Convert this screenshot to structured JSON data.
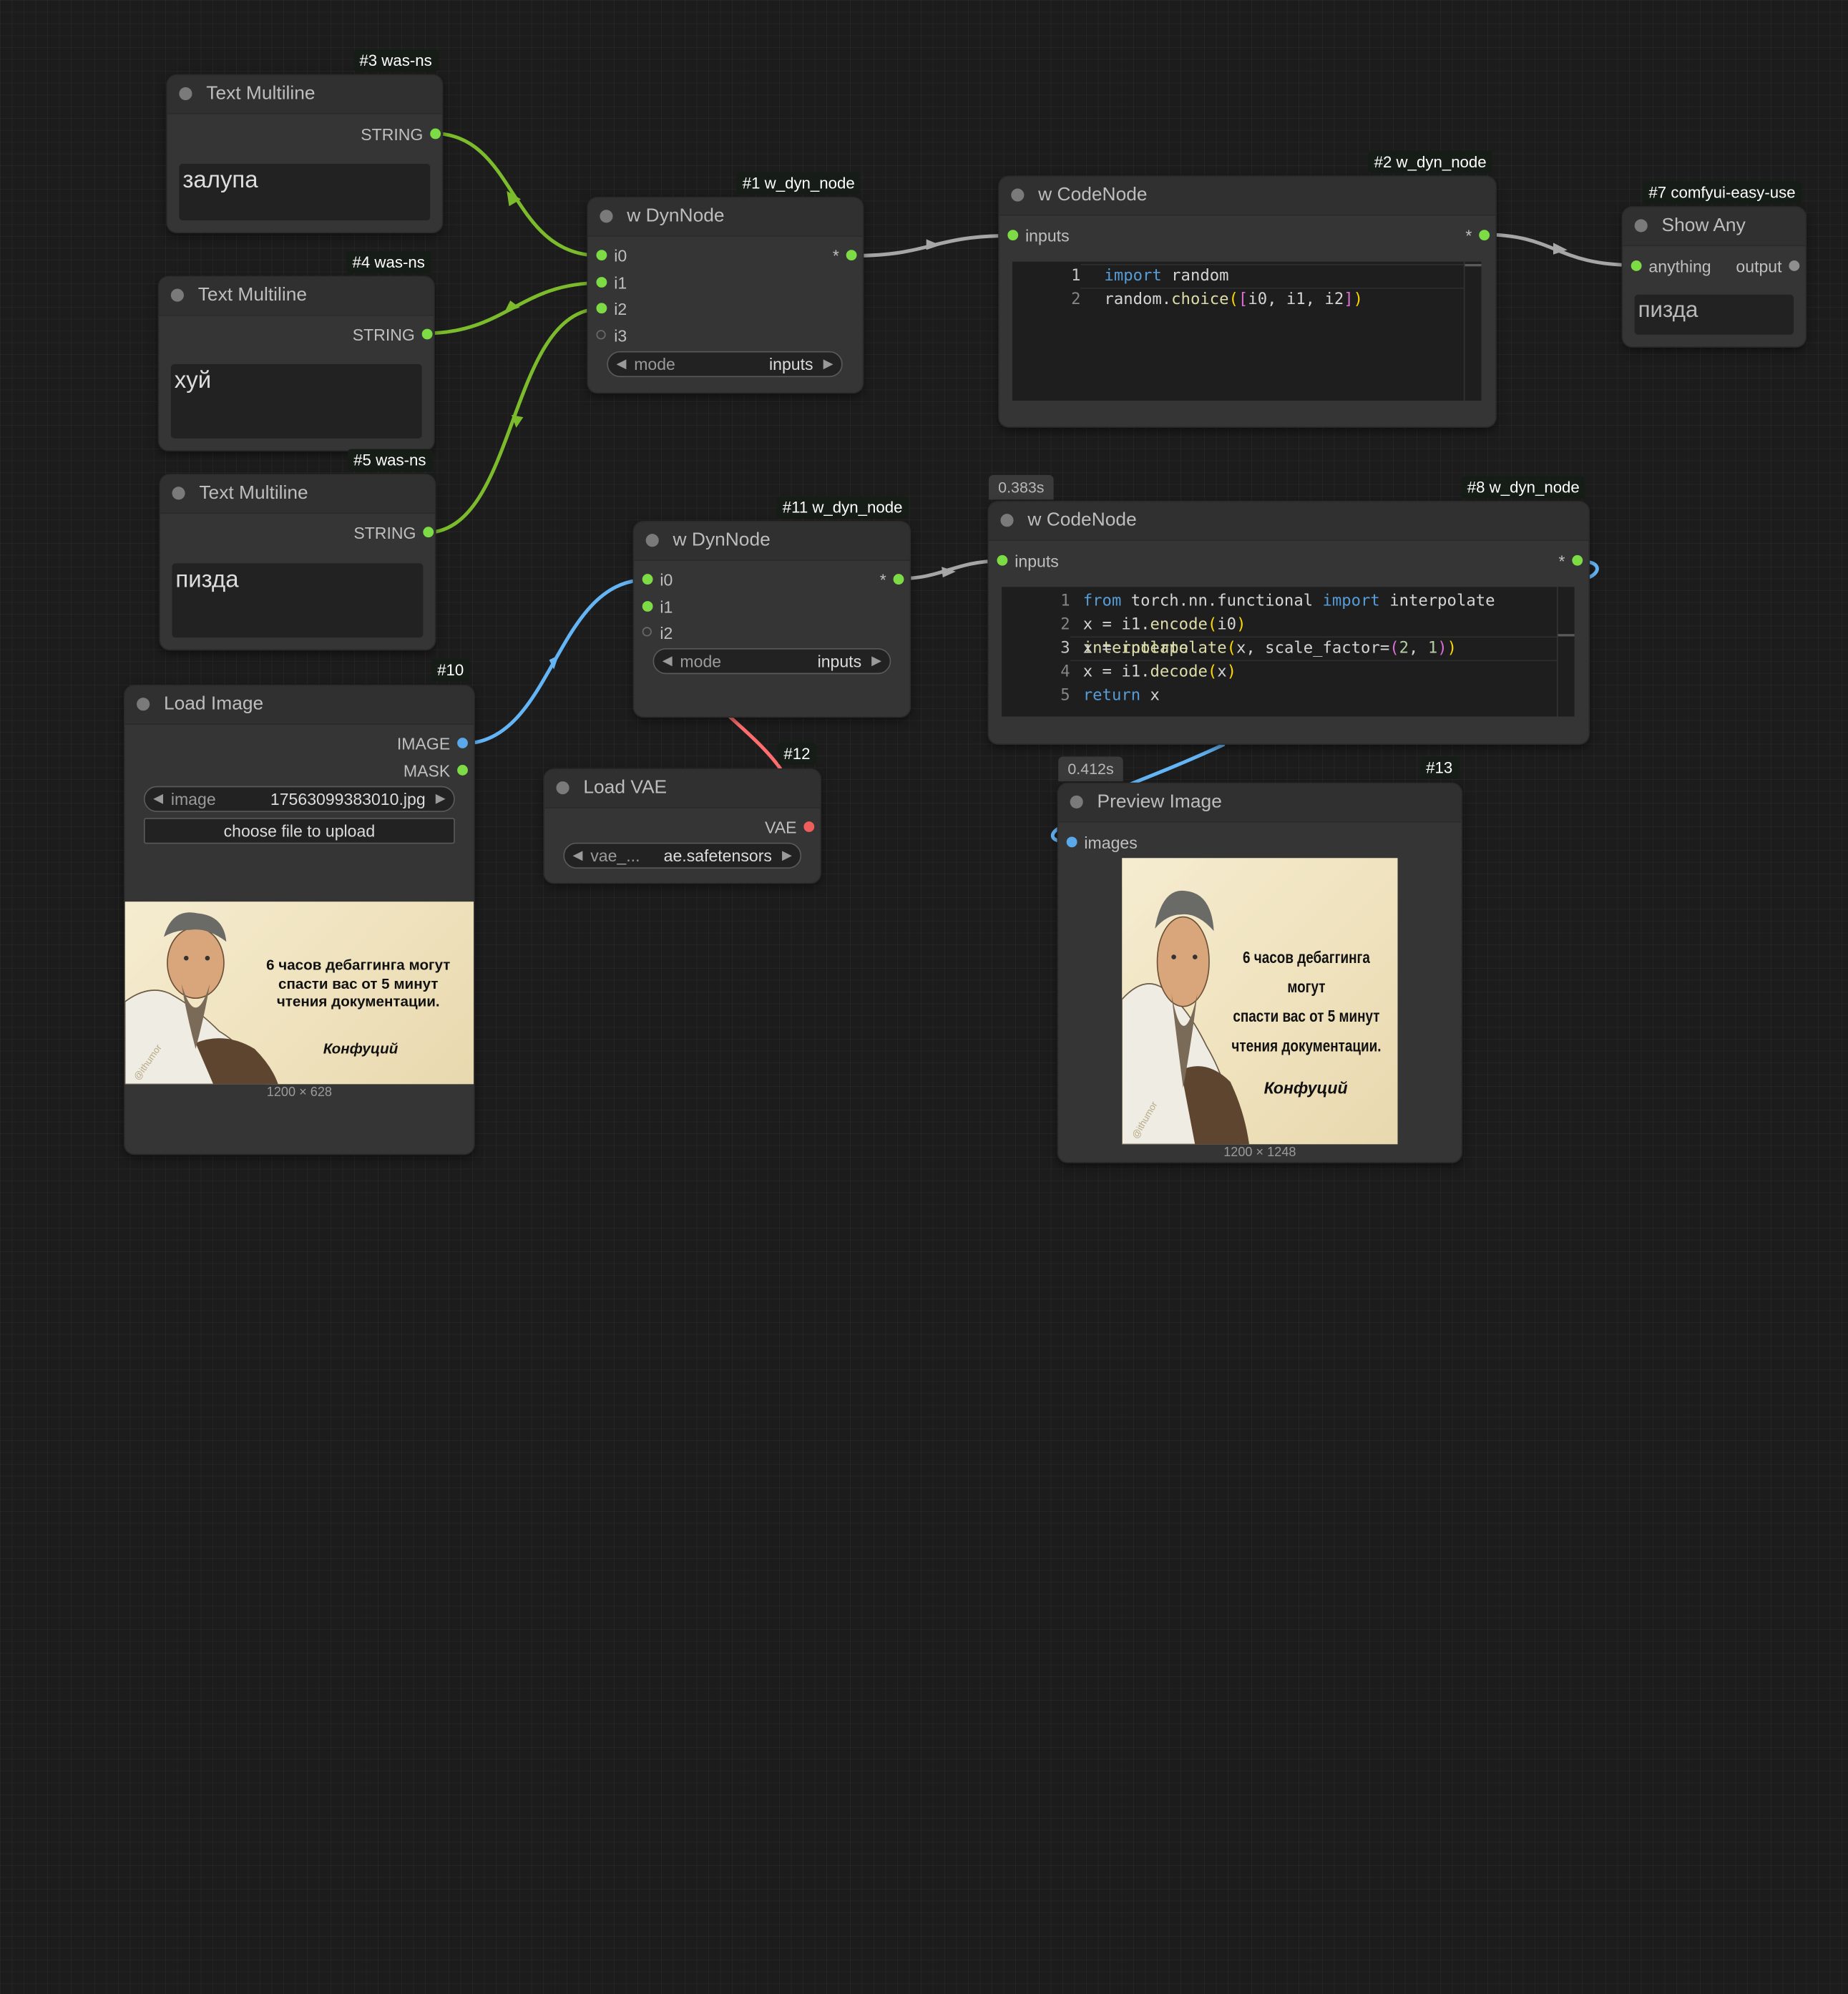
{
  "links": [
    {
      "from": "#3 STRING",
      "to": "#1 i0",
      "type": "STRING",
      "color": "#7cbb2c"
    },
    {
      "from": "#4 STRING",
      "to": "#1 i1",
      "type": "STRING",
      "color": "#7cbb2c"
    },
    {
      "from": "#5 STRING",
      "to": "#1 i2",
      "type": "STRING",
      "color": "#7cbb2c"
    },
    {
      "from": "#1 *",
      "to": "#2 inputs",
      "type": "*",
      "color": "#a6a6a6"
    },
    {
      "from": "#2 *",
      "to": "#7 anything",
      "type": "*",
      "color": "#a6a6a6"
    },
    {
      "from": "#10 IMAGE",
      "to": "#11 i0",
      "type": "IMAGE",
      "color": "#64b5f6"
    },
    {
      "from": "#11 *",
      "to": "#8 inputs",
      "type": "*",
      "color": "#a6a6a6"
    },
    {
      "from": "#12 VAE",
      "to": "#11 i1",
      "type": "VAE",
      "color": "#ff6e6e"
    },
    {
      "from": "#8 *",
      "to": "#13 images",
      "type": "IMAGE",
      "color": "#64b5f6"
    }
  ],
  "nodes": {
    "n3": {
      "badge": "#3 was-ns",
      "title": "Text Multiline",
      "output": "STRING",
      "text": "залупа"
    },
    "n4": {
      "badge": "#4 was-ns",
      "title": "Text Multiline",
      "output": "STRING",
      "text": "хуй"
    },
    "n5": {
      "badge": "#5 was-ns",
      "title": "Text Multiline",
      "output": "STRING",
      "text": "пизда"
    },
    "n1": {
      "badge": "#1 w_dyn_node",
      "title": "w DynNode",
      "inputs": [
        "i0",
        "i1",
        "i2",
        "i3"
      ],
      "output": "*",
      "mode_label": "mode",
      "mode_value": "inputs"
    },
    "n2": {
      "badge": "#2 w_dyn_node",
      "title": "w CodeNode",
      "input": "inputs",
      "output": "*",
      "code": [
        {
          "n": "1",
          "text": "import random"
        },
        {
          "n": "2",
          "text": "random.choice([i0, i1, i2])"
        }
      ]
    },
    "n7": {
      "badge": "#7 comfyui-easy-use",
      "title": "Show Any",
      "input": "anything",
      "output": "output",
      "text": "пизда"
    },
    "n11": {
      "badge": "#11 w_dyn_node",
      "title": "w DynNode",
      "inputs": [
        "i0",
        "i1",
        "i2"
      ],
      "output": "*",
      "mode_label": "mode",
      "mode_value": "inputs"
    },
    "n8": {
      "time": "0.383s",
      "badge": "#8 w_dyn_node",
      "title": "w CodeNode",
      "input": "inputs",
      "output": "*",
      "code": [
        {
          "n": "1",
          "text": "from torch.nn.functional import interpolate"
        },
        {
          "n": "2",
          "text": "x = i1.encode(i0)"
        },
        {
          "n": "3",
          "text": "x = interpolate(x, scale_factor=(2, 1))"
        },
        {
          "n": "4",
          "text": "x = i1.decode(x)"
        },
        {
          "n": "5",
          "text": "return x"
        }
      ]
    },
    "n10": {
      "badge": "#10",
      "title": "Load Image",
      "outputs": [
        "IMAGE",
        "MASK"
      ],
      "image_label": "image",
      "image_value": "17563099383010.jpg",
      "upload_label": "choose file to upload",
      "dims": "1200 × 628",
      "poster": {
        "lines": [
          "6 часов дебаггинга могут",
          "спасти вас от 5 минут",
          "чтения документации."
        ],
        "author": "Конфуций",
        "watermark": "@ithumor"
      }
    },
    "n12": {
      "badge": "#12",
      "title": "Load VAE",
      "output": "VAE",
      "vae_label": "vae_...",
      "vae_value": "ae.safetensors"
    },
    "n13": {
      "time": "0.412s",
      "badge": "#13",
      "title": "Preview Image",
      "input": "images",
      "dims": "1200 × 1248",
      "poster": {
        "lines": [
          "6 часов дебаггинга могут",
          "спасти вас от 5 минут",
          "чтения документации."
        ],
        "author": "Конфуций",
        "watermark": "@ithumor"
      }
    }
  }
}
